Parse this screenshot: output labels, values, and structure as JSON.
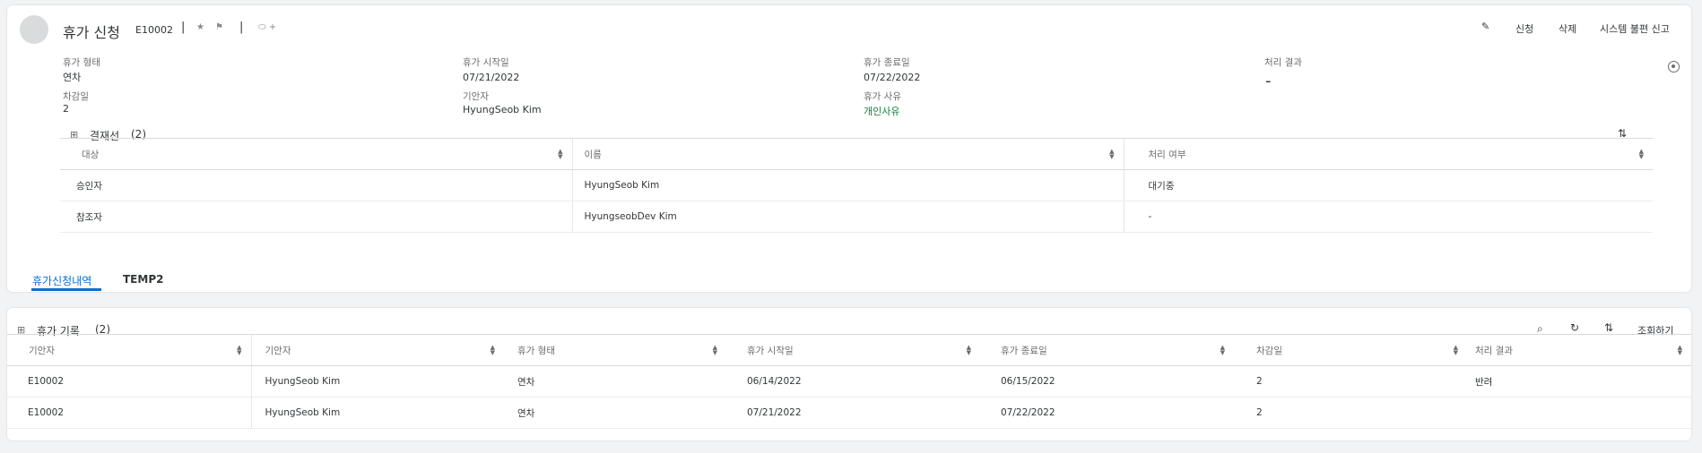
{
  "header": {
    "title": "휴가 신청",
    "subtitle": "E10002",
    "actions": {
      "edit_icon": "pencil-icon",
      "apply": "신청",
      "delete": "삭제",
      "report": "시스템 불편 신고"
    }
  },
  "fields": {
    "leave_type": {
      "label": "휴가 형태",
      "value": "연차"
    },
    "start_date": {
      "label": "휴가 시작일",
      "value": "07/21/2022"
    },
    "end_date": {
      "label": "휴가 종료일",
      "value": "07/22/2022"
    },
    "result": {
      "label": "처리 결과",
      "value": "-"
    },
    "deduct_days": {
      "label": "차감일",
      "value": "2"
    },
    "drafter": {
      "label": "기안자",
      "value": "HyungSeob Kim"
    },
    "reason": {
      "label": "휴가 사유",
      "value": "개인사유"
    }
  },
  "approval": {
    "title": "결재선",
    "count": "(2)",
    "columns": [
      "대상",
      "이름",
      "처리 여부"
    ],
    "rows": [
      [
        "승인자",
        "HyungSeob Kim",
        "대기중"
      ],
      [
        "참조자",
        "HyungseobDev Kim",
        "-"
      ]
    ]
  },
  "tabs": [
    {
      "label": "휴가신청내역",
      "active": true
    },
    {
      "label": "TEMP2",
      "active": false
    }
  ],
  "records": {
    "title": "휴가 기록",
    "count": "(2)",
    "query_label": "조회하기",
    "columns": [
      "기안자",
      "기안자",
      "휴가 형태",
      "휴가 시작일",
      "휴가 종료일",
      "차감일",
      "처리 결과"
    ],
    "rows": [
      [
        "E10002",
        "HyungSeob Kim",
        "연차",
        "06/14/2022",
        "06/15/2022",
        "2",
        "반려"
      ],
      [
        "E10002",
        "HyungSeob Kim",
        "연차",
        "07/21/2022",
        "07/22/2022",
        "2",
        ""
      ]
    ]
  },
  "colors": {
    "accent": "#0a6ed1",
    "positive": "#107e3e"
  }
}
